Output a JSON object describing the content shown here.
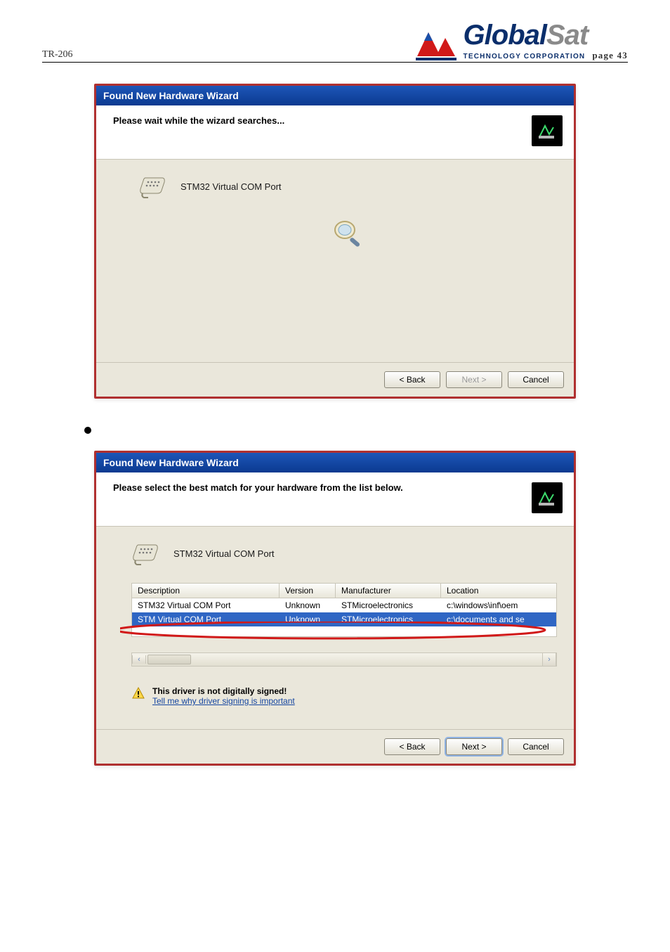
{
  "header": {
    "doc_id": "TR-206",
    "logo_word_a": "Global",
    "logo_word_b": "Sat",
    "logo_sub": "TECHNOLOGY CORPORATION",
    "page_num": "page 43"
  },
  "wizard1": {
    "title": "Found New Hardware Wizard",
    "head_text": "Please wait while the wizard searches...",
    "device_name": "STM32 Virtual COM Port",
    "buttons": {
      "back": "< Back",
      "next": "Next >",
      "cancel": "Cancel"
    }
  },
  "wizard2": {
    "title": "Found New Hardware Wizard",
    "head_text": "Please select the best match for your hardware from the list below.",
    "device_name": "STM32 Virtual COM Port",
    "columns": {
      "desc": "Description",
      "ver": "Version",
      "mfr": "Manufacturer",
      "loc": "Location"
    },
    "rows": [
      {
        "desc": "STM32 Virtual COM Port",
        "ver": "Unknown",
        "mfr": "STMicroelectronics",
        "loc": "c:\\windows\\inf\\oem"
      },
      {
        "desc": "STM Virtual COM Port",
        "ver": "Unknown",
        "mfr": "STMicroelectronics",
        "loc": "c:\\documents and se"
      }
    ],
    "sign_warn_title": "This driver is not digitally signed!",
    "sign_warn_link": "Tell me why driver signing is important",
    "buttons": {
      "back": "< Back",
      "next": "Next >",
      "cancel": "Cancel"
    }
  }
}
